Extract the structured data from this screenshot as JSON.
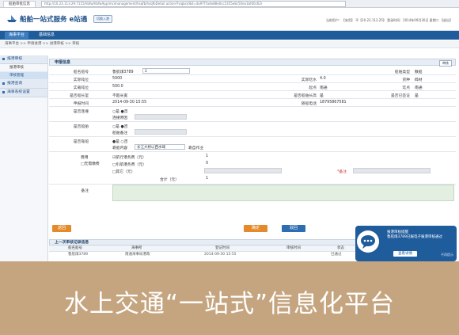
{
  "browser": {
    "tab_title": "船舶审批信息",
    "url": "http://10.23.113.29:7115/hbfw/hbfwApp/mcimanagement/hsqfb/hsqfbDetail.action?hsqbcId&f=4a97f7a4e88e0cc5355e8c50ea1bfd0c62r"
  },
  "header": {
    "title": "船舶一站式服务 e站通",
    "switch_button": "切换入港",
    "info": "当前用户：【安用】 平【10.23.113.25】 登录时间：2014年09月30日 星期二 【退出】"
  },
  "nav": {
    "items": [
      "海事平台",
      "基础信息"
    ]
  },
  "breadcrumb": "海事平台 >> 申请进港 >> 进港审核 >> 审核",
  "sidebar": {
    "groups": [
      {
        "label": "报港审核",
        "items": [
          "报港审核",
          "审核管理"
        ]
      },
      {
        "label": "报港查询",
        "items": []
      },
      {
        "label": "海事系统设置",
        "items": []
      }
    ]
  },
  "panel": {
    "title": "申报信息",
    "top_right_button": "审核"
  },
  "form": {
    "ship_name_label": "船名船号",
    "ship_name_value": "鲁航煤3789",
    "ship_name_input": "2",
    "ship_type_label": "船舶类型",
    "ship_type_value": "散船",
    "ton_label": "实际吨位",
    "ton_value": "5000",
    "draft_label": "实际吃水",
    "draft_value": "4.0",
    "cargo_label": "货种",
    "cargo_value": "碎材",
    "load_label": "实载吨位",
    "load_value": "500.0",
    "from_label": "起点",
    "from_value": "南通",
    "to_label": "迄点",
    "to_value": "南通",
    "captain_label": "是否船长室",
    "captain_value": "不超长宽",
    "verify_label": "是否船舶长高",
    "verify_value": "是",
    "signed_label": "是否已签证",
    "signed_value": "是",
    "time_label": "申报时间",
    "time_value": "2014-09-30 15:55",
    "phone_label": "随船电话",
    "phone_value": "18795867581",
    "join_label": "是否连撞",
    "join_options": "○是 ●否",
    "join_no_label": "连撞原因",
    "fleet_label": "是否船舶",
    "fleet_options": "○是 ●否",
    "fleet_no_label": "船舶备注",
    "berth_label": "是否靠船",
    "berth_options": "●是 ○否",
    "berth_detail_label": "靠船内容",
    "berth_select": "长江大桥以西水域",
    "berth_suffix": "靠自作业",
    "fee_label": "费用",
    "fee_free": "□无需缴费",
    "fee_items": [
      {
        "label": "☑航行港务费（元）",
        "value": "1"
      },
      {
        "label": "□引航港务费（元）",
        "value": "0"
      },
      {
        "label": "□其它（元）",
        "value": "",
        "note": "*备注"
      }
    ],
    "total_label": "合计（元）",
    "total_value": "1",
    "remark_label": "备注"
  },
  "buttons": {
    "back": "返回",
    "confirm": "确定",
    "reject": "驳回"
  },
  "history": {
    "title": "上一次审核记录信息",
    "columns": [
      "船名船号",
      "海事所",
      "登记时间",
      "审核时间",
      "状态"
    ],
    "row": [
      "鲁航煤3789",
      "南通海事局港政",
      "2014-09-30 15:55",
      "",
      "已通过"
    ]
  },
  "chat": {
    "title": "报港审核提醒",
    "message": "鲁航煤3789已报电子报港审核通过",
    "button": "查看详情",
    "side": "不再提示"
  },
  "caption": "水上交通“一站式”信息化平台",
  "colors": {
    "nav_blue": "#1f5c9c",
    "band_tan": "#c5a57f",
    "confirm_orange": "#e58a2b"
  }
}
